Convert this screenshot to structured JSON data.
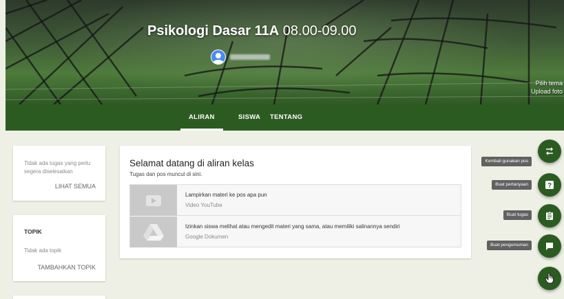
{
  "header": {
    "class_name": "Psikologi Dasar 11A",
    "class_time": "08.00-09.00",
    "pick_theme": "Pilih tema",
    "upload_photo": "Upload foto"
  },
  "tabs": [
    {
      "label": "ALIRAN",
      "active": true
    },
    {
      "label": "SISWA",
      "active": false
    },
    {
      "label": "TENTANG",
      "active": false
    }
  ],
  "upcoming": {
    "message": "Tidak ada tugas yang perlu segera diselesaikan",
    "view_all": "LIHAT SEMUA"
  },
  "topics": {
    "heading": "TOPIK",
    "message": "Tidak ada topik",
    "add": "TAMBAHKAN TOPIK"
  },
  "stream": {
    "heading": "Selamat datang di aliran kelas",
    "subheading": "Tugas dan pos muncul di sini.",
    "items": [
      {
        "title": "Lampirkan materi ke pos apa pun",
        "source": "Video YouTube",
        "icon": "play-icon"
      },
      {
        "title": "Izinkan siswa melihat atau mengedit materi yang sama, atau memiliki salinannya sendiri",
        "source": "Google Dokumen",
        "icon": "drive-icon"
      }
    ]
  },
  "actions": [
    {
      "label": "Kembali gunakan pos",
      "icon": "reuse-icon"
    },
    {
      "label": "Buat pertanyaan",
      "icon": "question-icon"
    },
    {
      "label": "Buat tugas",
      "icon": "assignment-icon"
    },
    {
      "label": "Buat pengumuman",
      "icon": "announcement-icon"
    }
  ],
  "colors": {
    "primary": "#2c5b21",
    "background": "#eef0e6",
    "tooltip": "#616161"
  }
}
